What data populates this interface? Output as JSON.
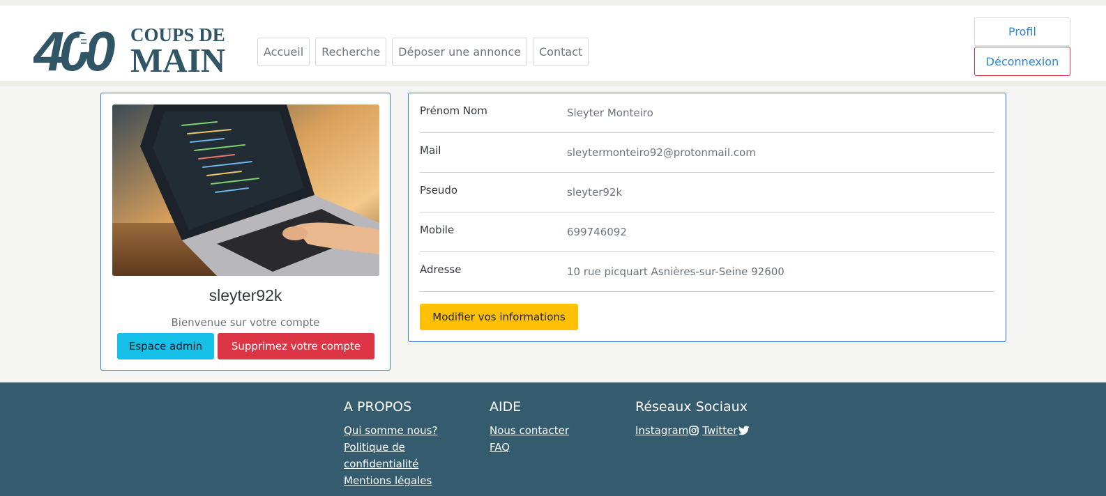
{
  "brand": {
    "number": "400",
    "line1": "COUPS DE",
    "line2": "MAIN",
    "color": "#2f5566"
  },
  "nav": {
    "items": [
      {
        "label": "Accueil"
      },
      {
        "label": "Recherche"
      },
      {
        "label": "Déposer une annonce"
      },
      {
        "label": "Contact"
      }
    ]
  },
  "account": {
    "profile_label": "Profil",
    "logout_label": "Déconnexion"
  },
  "profile": {
    "username": "sleyter92k",
    "welcome": "Bienvenue sur votre compte",
    "admin_label": "Espace admin",
    "delete_label": "Supprimez votre compte"
  },
  "details": {
    "rows": [
      {
        "label": "Prénom Nom",
        "value": "Sleyter Monteiro"
      },
      {
        "label": "Mail",
        "value": "sleytermonteiro92@protonmail.com"
      },
      {
        "label": "Pseudo",
        "value": "sleyter92k"
      },
      {
        "label": "Mobile",
        "value": "699746092"
      },
      {
        "label": "Adresse",
        "value": "10 rue picquart Asnières-sur-Seine 92600"
      }
    ],
    "edit_label": "Modifier vos informations"
  },
  "footer": {
    "about": {
      "title": "A PROPOS",
      "links": [
        "Qui somme nous?",
        "Politique de confidentialité",
        "Mentions légales"
      ]
    },
    "help": {
      "title": "AIDE",
      "links": [
        "Nous contacter",
        "FAQ"
      ]
    },
    "social": {
      "title": "Réseaux Sociaux",
      "instagram": "Instagram",
      "twitter": "Twitter"
    }
  },
  "colors": {
    "primary_border": "#2f7fe0",
    "info": "#17c0e8",
    "danger": "#dc3545",
    "warning": "#ffc107",
    "footer": "#355c6e"
  }
}
